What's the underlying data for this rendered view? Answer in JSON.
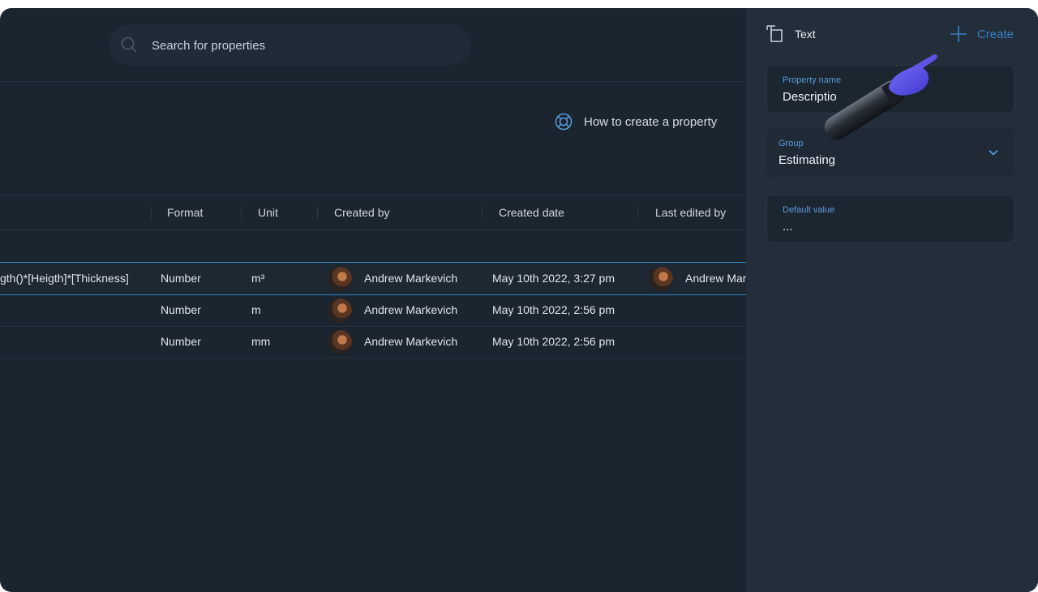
{
  "search": {
    "placeholder": "Search for properties"
  },
  "help": {
    "label": "How to create a property"
  },
  "table": {
    "headers": [
      "Format",
      "Unit",
      "Created by",
      "Created date",
      "Last edited by"
    ],
    "rows": [
      {
        "formula": "gth()*[Heigth]*[Thickness]",
        "format": "Number",
        "unit": "m³",
        "created_by": "Andrew Markevich",
        "created_date": "May 10th 2022, 3:27 pm",
        "last_edited_by": "Andrew Mar"
      },
      {
        "formula": "",
        "format": "Number",
        "unit": "m",
        "created_by": "Andrew Markevich",
        "created_date": "May 10th 2022, 2:56 pm",
        "last_edited_by": ""
      },
      {
        "formula": "",
        "format": "Number",
        "unit": "mm",
        "created_by": "Andrew Markevich",
        "created_date": "May 10th 2022, 2:56 pm",
        "last_edited_by": ""
      }
    ]
  },
  "panel": {
    "type_label": "Text",
    "create_label": "Create",
    "property_name": {
      "label": "Property name",
      "value": "Descriptio"
    },
    "group": {
      "label": "Group",
      "value": "Estimating"
    },
    "default_value": {
      "label": "Default value",
      "value": "..."
    }
  },
  "icons": {
    "search": "search-icon",
    "help": "lifebuoy-icon",
    "type": "text-type-icon",
    "create": "plus-icon",
    "chevron": "chevron-down-icon"
  },
  "colors": {
    "background": "#1b2530",
    "panel": "#232e3b",
    "accent": "#3a7fc4",
    "label_blue": "#5c9bd9",
    "selected_border": "#2e86c8"
  }
}
